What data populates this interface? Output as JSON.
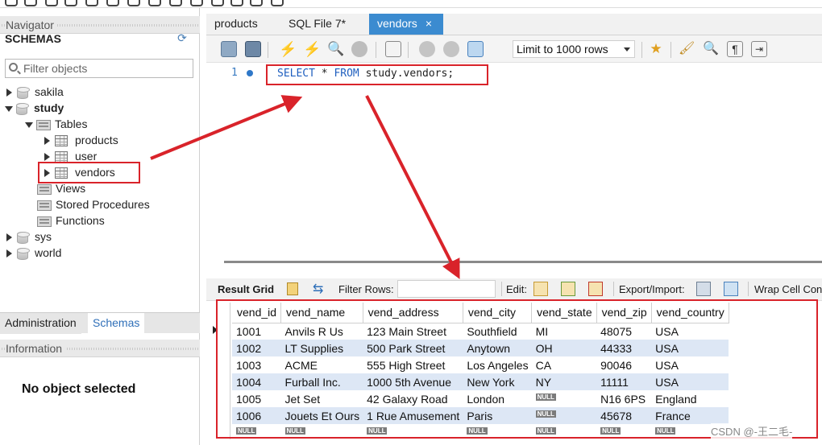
{
  "navigator": {
    "title": "Navigator",
    "schemas_title": "SCHEMAS",
    "filter_placeholder": "Filter objects",
    "tree": {
      "sakila": "sakila",
      "study": "study",
      "tables": "Tables",
      "products": "products",
      "user": "user",
      "vendors": "vendors",
      "views": "Views",
      "stored_procedures": "Stored Procedures",
      "functions": "Functions",
      "sys": "sys",
      "world": "world"
    },
    "bottom_tabs": [
      "Administration",
      "Schemas"
    ],
    "information_title": "Information",
    "no_object": "No object selected"
  },
  "tabs": [
    {
      "label": "products"
    },
    {
      "label": "SQL File 7*"
    },
    {
      "label": "vendors",
      "close": "×"
    }
  ],
  "toolbar": {
    "limit": "Limit to 1000 rows"
  },
  "editor": {
    "line_number": "1",
    "kw_select": "SELECT",
    "star": " * ",
    "kw_from": "FROM",
    "rest": " study.vendors;"
  },
  "result_toolbar": {
    "result_grid": "Result Grid",
    "filter_rows": "Filter Rows:",
    "edit": "Edit:",
    "export_import": "Export/Import:",
    "wrap": "Wrap Cell Cont"
  },
  "grid": {
    "columns": [
      "vend_id",
      "vend_name",
      "vend_address",
      "vend_city",
      "vend_state",
      "vend_zip",
      "vend_country"
    ],
    "rows": [
      [
        "1001",
        "Anvils R Us",
        "123 Main Street",
        "Southfield",
        "MI",
        "48075",
        "USA"
      ],
      [
        "1002",
        "LT Supplies",
        "500 Park Street",
        "Anytown",
        "OH",
        "44333",
        "USA"
      ],
      [
        "1003",
        "ACME",
        "555 High Street",
        "Los Angeles",
        "CA",
        "90046",
        "USA"
      ],
      [
        "1004",
        "Furball Inc.",
        "1000 5th Avenue",
        "New York",
        "NY",
        "11111",
        "USA"
      ],
      [
        "1005",
        "Jet Set",
        "42 Galaxy Road",
        "London",
        "NULL",
        "N16 6PS",
        "England"
      ],
      [
        "1006",
        "Jouets Et Ours",
        "1 Rue Amusement",
        "Paris",
        "NULL",
        "45678",
        "France"
      ],
      [
        "NULL",
        "NULL",
        "NULL",
        "NULL",
        "NULL",
        "NULL",
        "NULL"
      ]
    ],
    "null_label": "NULL"
  },
  "watermark": "CSDN @-王二毛-",
  "colors": {
    "accent": "#3b8bd0",
    "highlight_red": "#d9232a",
    "row_alt": "#dde7f5"
  }
}
